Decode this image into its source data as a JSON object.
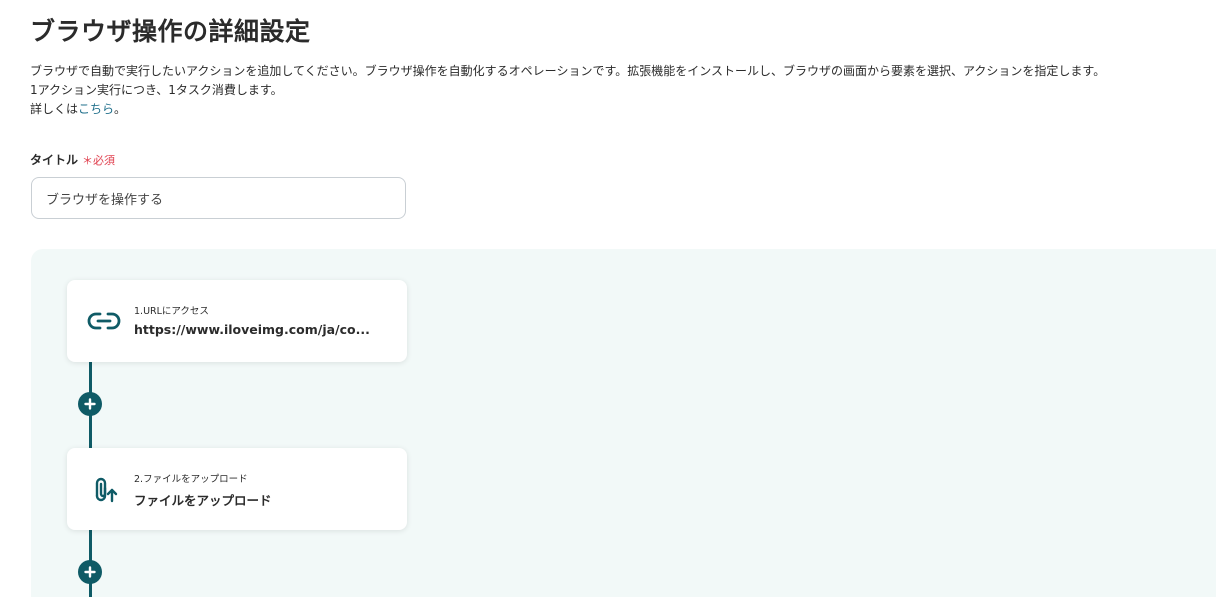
{
  "header": {
    "title": "ブラウザ操作の詳細設定",
    "description_line1": "ブラウザで自動で実行したいアクションを追加してください。ブラウザ操作を自動化するオペレーションです。拡張機能をインストールし、ブラウザの画面から要素を選択、アクションを指定します。",
    "description_line2": "1アクション実行につき、1タスク消費します。",
    "description_line3_prefix": "詳しくは",
    "description_link": "こちら",
    "description_line3_suffix": "。"
  },
  "title_field": {
    "label": "タイトル",
    "required": "＊必須",
    "value": "ブラウザを操作する"
  },
  "flow": {
    "steps": [
      {
        "label": "1.URLにアクセス",
        "value": "https://www.iloveimg.com/ja/co...",
        "icon": "link-icon"
      },
      {
        "label": "2.ファイルをアップロード",
        "value": "ファイルをアップロード",
        "icon": "paperclip-upload-icon"
      }
    ],
    "add_icon": "plus-icon"
  },
  "colors": {
    "accent": "#0f5b66",
    "link": "#1f6f8b",
    "required": "#e0404f",
    "flow_background": "#f2f9f8"
  }
}
